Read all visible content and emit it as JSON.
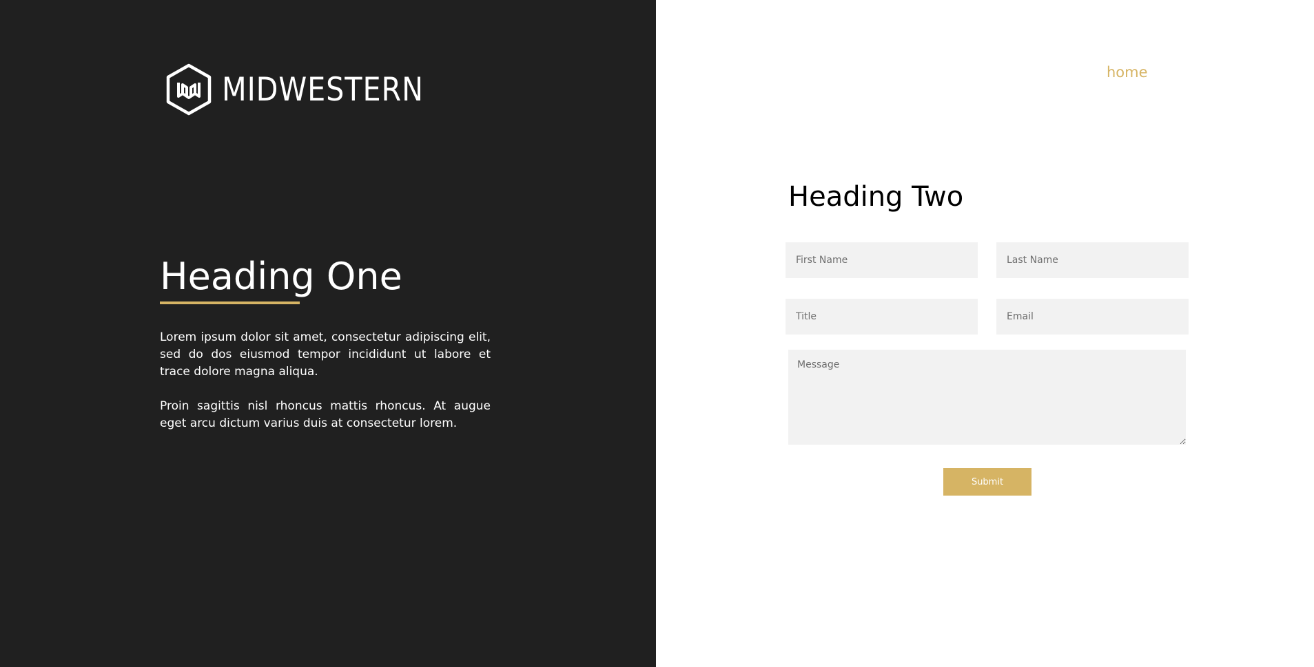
{
  "brand": {
    "logo_icon": "hexagon-monogram-icon",
    "name": "MIDWESTERN",
    "accent_color": "#d6b464"
  },
  "left": {
    "heading": "Heading One",
    "paragraphs": [
      "Lorem ipsum dolor sit amet, consectetur adipiscing elit, sed do dos eiusmod tempor incididunt ut labore et trace dolore magna aliqua.",
      "Proin sagittis nisl rhoncus mattis rhoncus. At augue eget arcu dictum varius duis at consectetur lorem."
    ],
    "background_color": "#202020"
  },
  "nav": {
    "home_label": "home"
  },
  "form": {
    "heading": "Heading Two",
    "first_name_placeholder": "First Name",
    "last_name_placeholder": "Last Name",
    "title_placeholder": "Title",
    "email_placeholder": "Email",
    "message_placeholder": "Message",
    "submit_label": "Submit",
    "field_background": "#f2f2f2"
  }
}
